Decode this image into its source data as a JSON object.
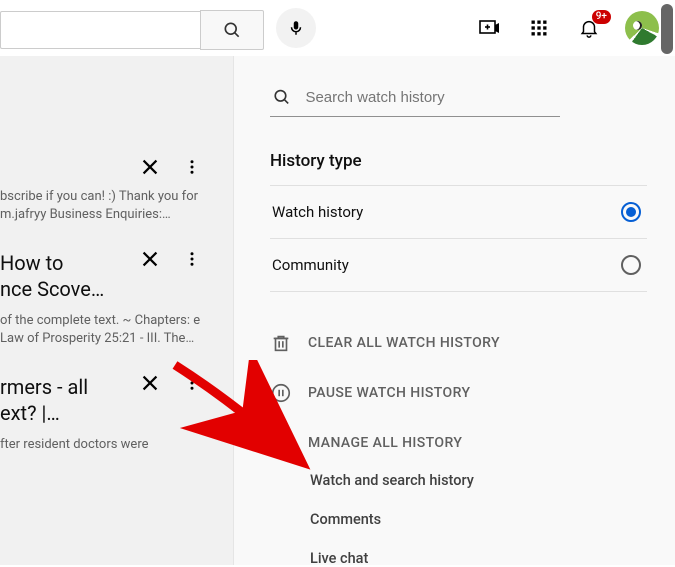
{
  "topbar": {
    "search_value": "",
    "notification_badge": "9+"
  },
  "left_panel": {
    "item1": {
      "desc": "bscribe if you can! :) Thank you for m.jafryy Business Enquiries:…"
    },
    "item2": {
      "title": "How to\nnce Scove…",
      "desc": "of the complete text. ~ Chapters: e Law of Prosperity 25:21 - III. The…"
    },
    "item3": {
      "title": "rmers - all\next? |…",
      "desc": "fter resident doctors were"
    }
  },
  "right_panel": {
    "search_placeholder": "Search watch history",
    "section_title": "History type",
    "types": {
      "watch": "Watch history",
      "community": "Community"
    },
    "actions": {
      "clear": "CLEAR ALL WATCH HISTORY",
      "pause": "PAUSE WATCH HISTORY",
      "manage": "MANAGE ALL HISTORY"
    },
    "sublinks": {
      "watch_search": "Watch and search history",
      "comments": "Comments",
      "live_chat": "Live chat"
    }
  }
}
